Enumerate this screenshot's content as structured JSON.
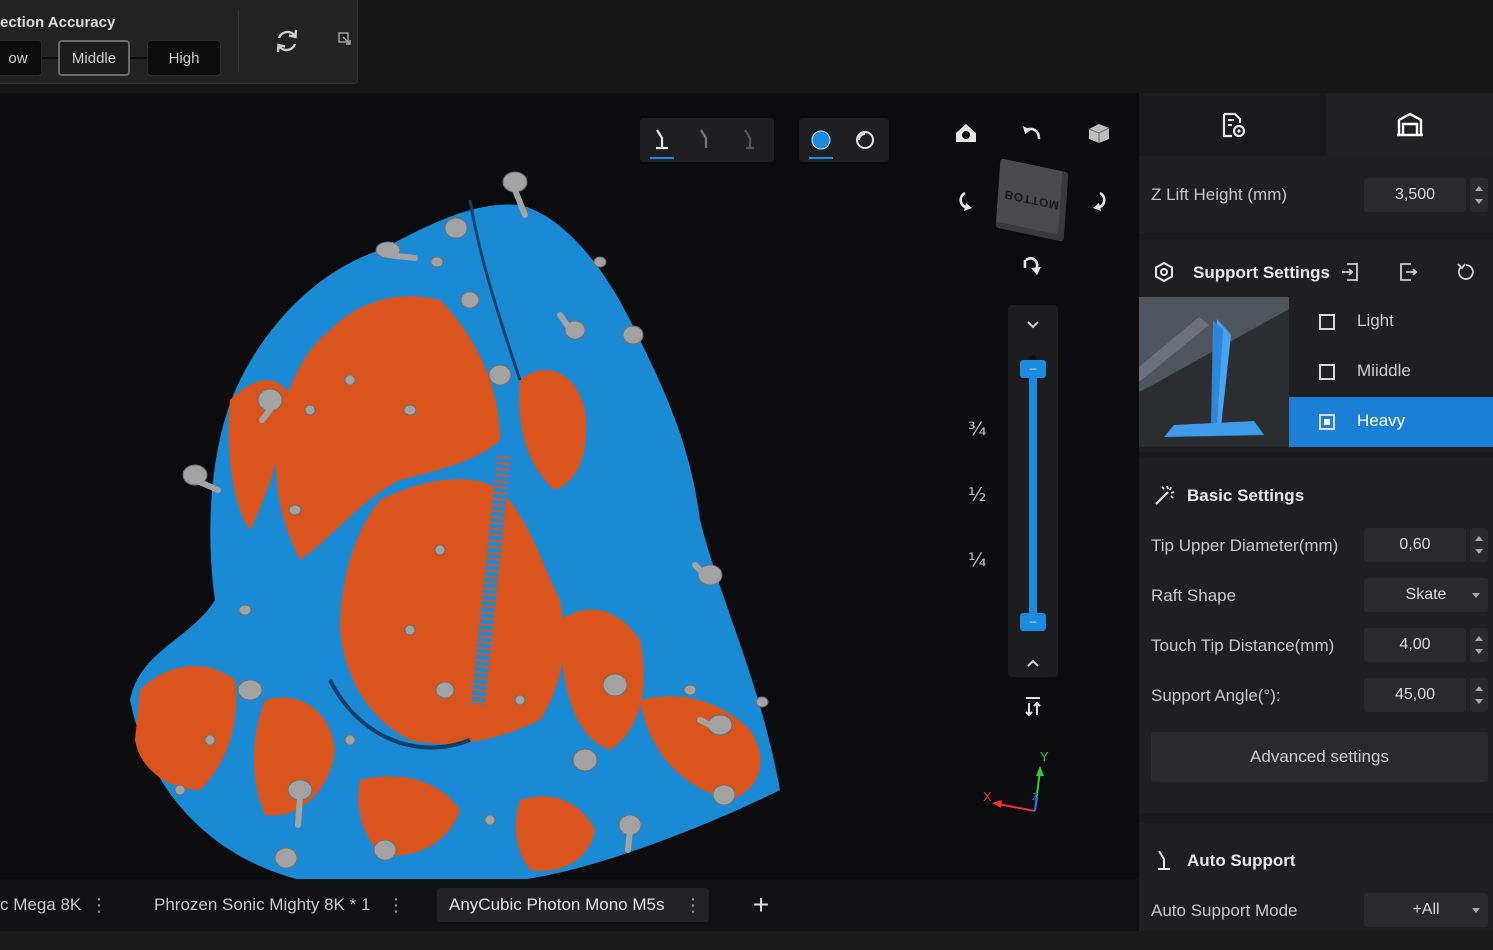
{
  "accuracy": {
    "title": "ection Accuracy",
    "options": [
      "ow",
      "Middle",
      "High"
    ],
    "selected": "Middle"
  },
  "viewport": {
    "navcube_face": "BOTTOM",
    "slider_marks": [
      "¾",
      "½",
      "¼"
    ],
    "slider_handle_glyph": "–",
    "axes": {
      "x": "X",
      "y": "Y",
      "z": "Z"
    },
    "colors": {
      "accent": "#1b8be0",
      "model_blue": "#1a8ad4",
      "model_orange": "#d9531c",
      "support": "#9a9a9a"
    }
  },
  "tabs": {
    "items": [
      {
        "label": "c Mega 8K",
        "active": false
      },
      {
        "label": "Phrozen Sonic Mighty 8K * 1",
        "active": false
      },
      {
        "label": "AnyCubic Photon Mono M5s",
        "active": true
      }
    ],
    "kebab": "⋮",
    "add": "+"
  },
  "rpanel": {
    "z_lift": {
      "label": "Z Lift Height (mm)",
      "value": "3,500"
    },
    "support_settings": {
      "title": "Support Settings",
      "presets": [
        {
          "label": "Light",
          "selected": false
        },
        {
          "label": "Miiddle",
          "selected": false
        },
        {
          "label": "Heavy",
          "selected": true
        }
      ]
    },
    "basic_settings": {
      "title": "Basic Settings",
      "tip_upper_diameter": {
        "label": "Tip Upper Diameter(mm)",
        "value": "0,60"
      },
      "raft_shape": {
        "label": "Raft Shape",
        "value": "Skate"
      },
      "touch_tip_distance": {
        "label": "Touch Tip Distance(mm)",
        "value": "4,00"
      },
      "support_angle": {
        "label": "Support Angle(°):",
        "value": "45,00"
      },
      "advanced_label": "Advanced settings"
    },
    "auto_support": {
      "title": "Auto Support",
      "mode": {
        "label": "Auto Support Mode",
        "value": "+All"
      }
    }
  }
}
